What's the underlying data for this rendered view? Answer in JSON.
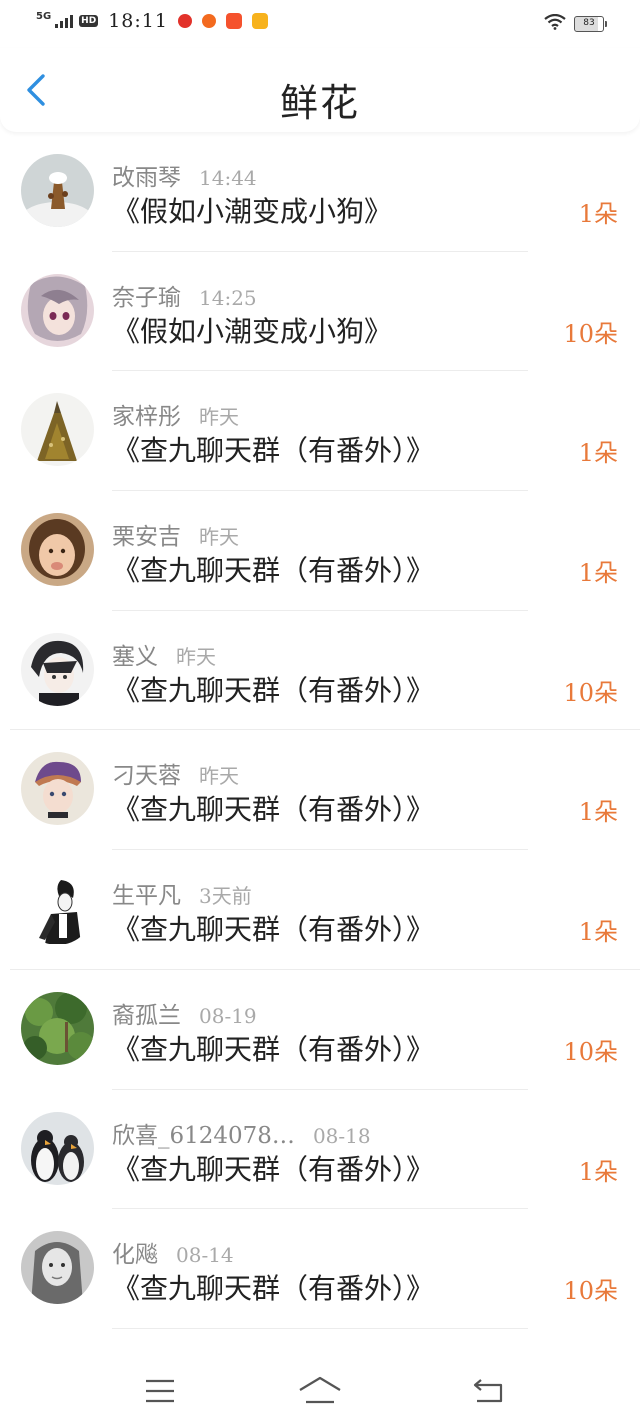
{
  "status_bar": {
    "network": "5G",
    "hd": "HD",
    "time": "18:11",
    "battery": "83",
    "app_icons": [
      "weibo-icon",
      "taobao-icon",
      "store-icon",
      "video-icon"
    ],
    "icons": [
      "signal-icon",
      "wifi-icon",
      "battery-icon"
    ]
  },
  "header": {
    "title": "鲜花",
    "back_icon": "chevron-left-icon"
  },
  "colors": {
    "accent_blue": "#2f8fe0",
    "count_orange": "#e8793a",
    "name_gray": "#888888",
    "time_gray": "#a9a9a9"
  },
  "rows": [
    {
      "name": "改雨琴",
      "time": "14:44",
      "title": "《假如小潮变成小狗》",
      "count": "1朵"
    },
    {
      "name": "奈子瑜",
      "time": "14:25",
      "title": "《假如小潮变成小狗》",
      "count": "10朵"
    },
    {
      "name": "家梓彤",
      "time": "昨天",
      "title": "《查九聊天群（有番外）》",
      "count": "1朵"
    },
    {
      "name": "栗安吉",
      "time": "昨天",
      "title": "《查九聊天群（有番外）》",
      "count": "1朵"
    },
    {
      "name": "塞义",
      "time": "昨天",
      "title": "《查九聊天群（有番外）》",
      "count": "10朵"
    },
    {
      "name": "刁天蓉",
      "time": "昨天",
      "title": "《查九聊天群（有番外）》",
      "count": "1朵"
    },
    {
      "name": "生平凡",
      "time": "3天前",
      "title": "《查九聊天群（有番外）》",
      "count": "1朵"
    },
    {
      "name": "裔孤兰",
      "time": "08-19",
      "title": "《查九聊天群（有番外）》",
      "count": "10朵"
    },
    {
      "name": "欣喜_6124078…",
      "time": "08-18",
      "title": "《查九聊天群（有番外）》",
      "count": "1朵"
    },
    {
      "name": "化飚",
      "time": "08-14",
      "title": "《查九聊天群（有番外）》",
      "count": "10朵"
    }
  ],
  "nav_bar": {
    "icons": [
      "menu-icon",
      "home-icon",
      "back-icon"
    ]
  }
}
